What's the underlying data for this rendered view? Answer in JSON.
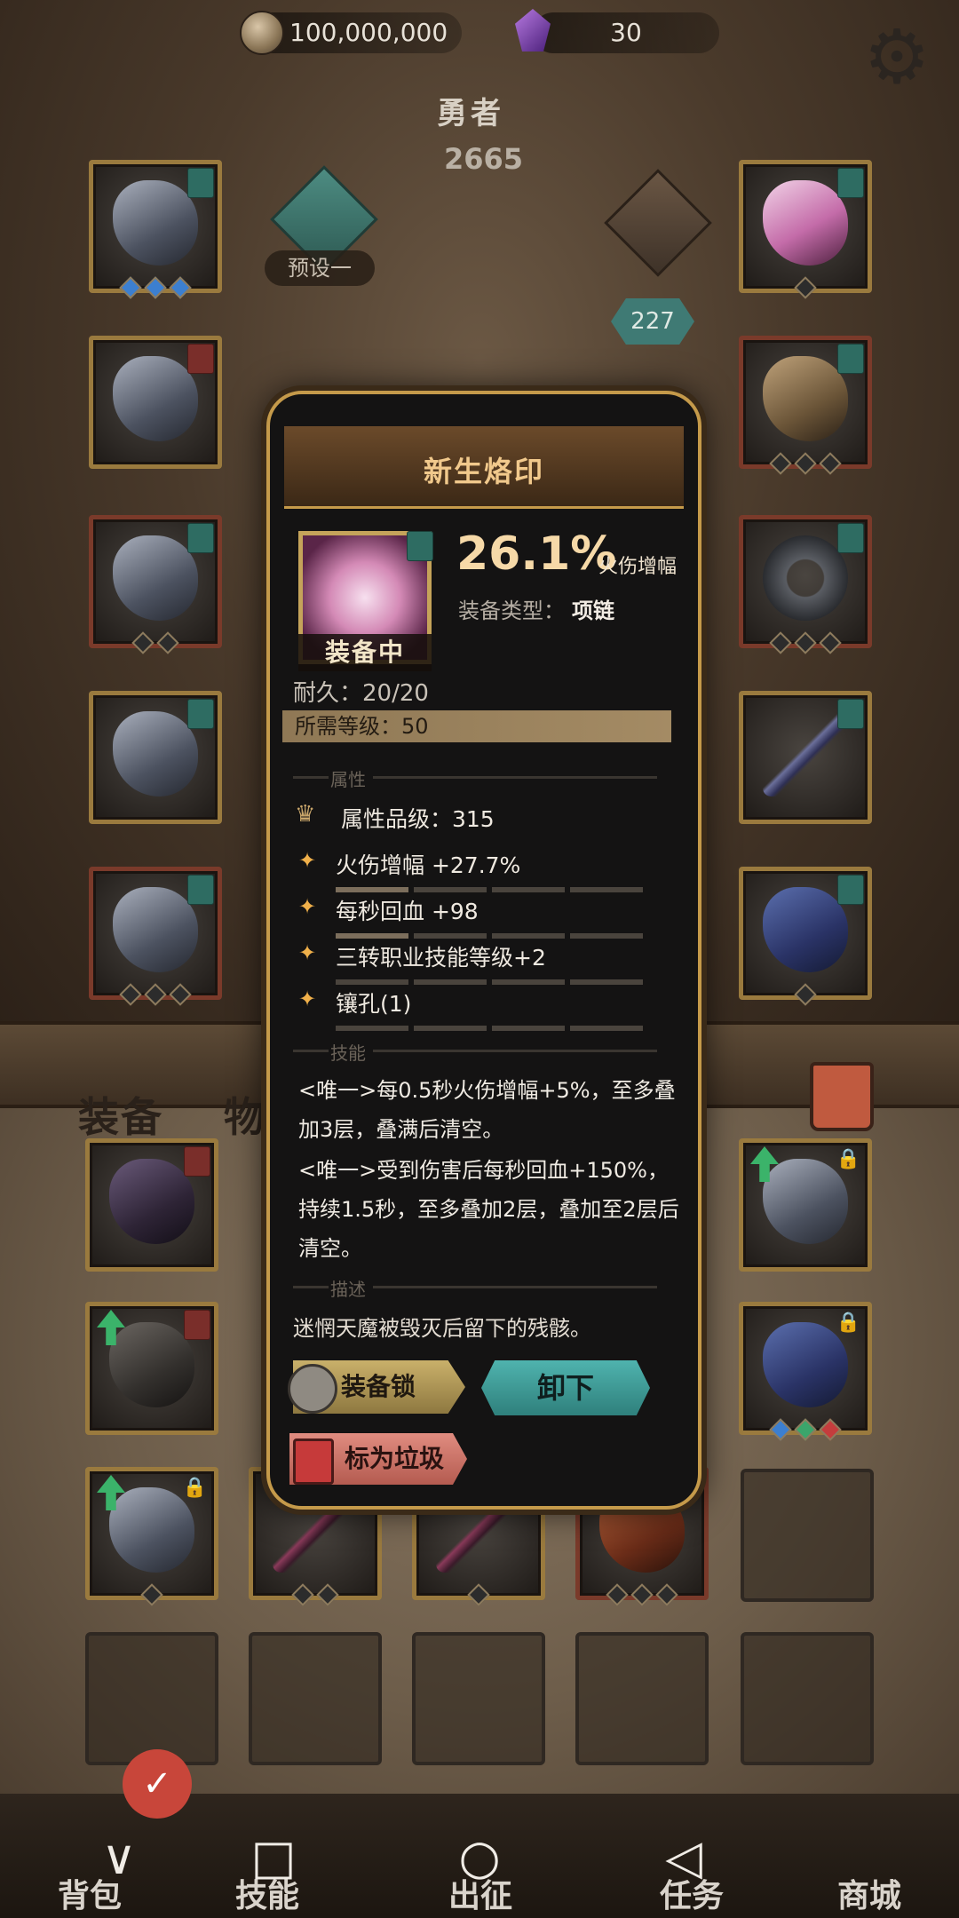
{
  "resources": {
    "coins": "100,000,000",
    "gems": "30"
  },
  "hero": {
    "name": "勇者",
    "power": "2665",
    "preset": "预设一",
    "level_badge": "227"
  },
  "bag_tabs": {
    "equip": "装备",
    "items": "物"
  },
  "nav": {
    "bag": "背包",
    "skills": "技能",
    "expedition": "出征",
    "tasks": "任务",
    "shop": "商城"
  },
  "system_nav": {
    "back": "∨",
    "home": "○",
    "recent": "◁",
    "square": "□"
  },
  "popup": {
    "title": "新生烙印",
    "equipped": "装备中",
    "main_stat_value": "26.1%",
    "main_stat_name": "火伤增幅",
    "type_label": "装备类型：",
    "type_value": "项链",
    "durability": "耐久：20/20",
    "required_level": "所需等级：50",
    "section_attr": "属性",
    "attr_quality": "属性品级：315",
    "attributes": [
      "火伤增幅 +27.7%",
      "每秒回血 +98",
      "三转职业技能等级+2",
      "镶孔(1)"
    ],
    "section_skill": "技能",
    "skills": [
      "<唯一>每0.5秒火伤增幅+5%，至多叠加3层，叠满后清空。",
      "<唯一>受到伤害后每秒回血+150%，持续1.5秒，至多叠加2层，叠加至2层后清空。"
    ],
    "section_desc": "描述",
    "description": "迷惘天魔被毁灭后留下的残骸。",
    "btn_lock": "装备锁",
    "btn_unequip": "卸下",
    "btn_trash": "标为垃圾"
  },
  "colors": {
    "gold_border": "#c59a4a",
    "teal": "#3f7a74",
    "accent_text": "#f6d9a8"
  }
}
